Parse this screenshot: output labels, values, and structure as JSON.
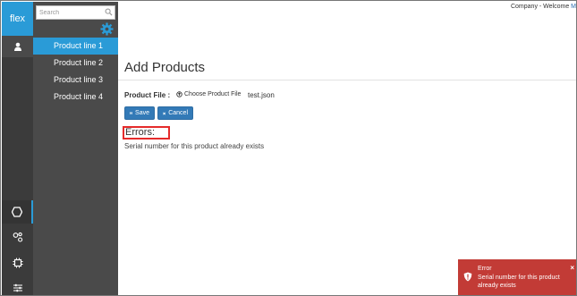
{
  "app": {
    "logo_text": "flex"
  },
  "header": {
    "company_text": "Company  - Welcome ",
    "user_truncated": "M"
  },
  "sidebar": {
    "search_placeholder": "Search",
    "items": [
      {
        "label": "Product line 1",
        "selected": true
      },
      {
        "label": "Product line 2",
        "selected": false
      },
      {
        "label": "Product line 3",
        "selected": false
      },
      {
        "label": "Product line 4",
        "selected": false
      }
    ]
  },
  "rail": {
    "icons": [
      "user-icon",
      "hexagon-icon",
      "nodes-icon",
      "chip-icon",
      "sliders-icon"
    ]
  },
  "main": {
    "title": "Add Products",
    "file_label": "Product File :",
    "choose_label": "Choose Product File",
    "file_name": "test.json",
    "save_label": "Save",
    "cancel_label": "Cancel",
    "errors_title": "Errors:",
    "error_message": "Serial number for this product already exists"
  },
  "toast": {
    "title": "Error",
    "message": "Serial number for this product already exists",
    "close": "×"
  },
  "colors": {
    "accent": "#2a9bd7",
    "sidebar": "#4a4a4a",
    "rail": "#3b3b3b",
    "button": "#337ab7",
    "error": "#c23b36"
  }
}
